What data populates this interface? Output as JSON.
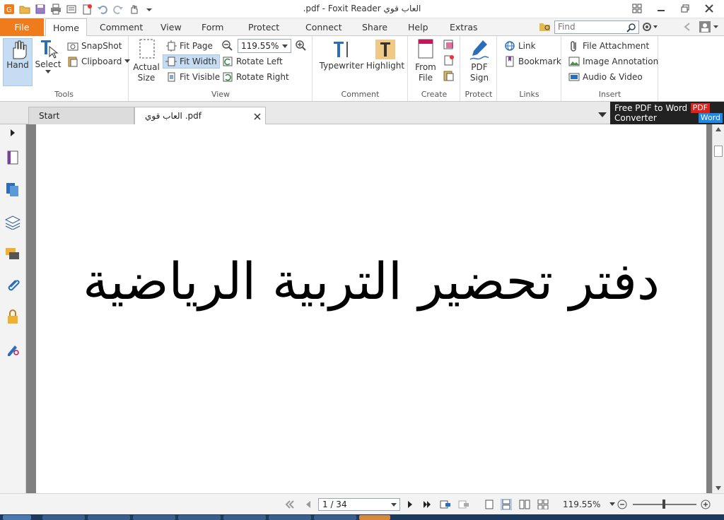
{
  "window": {
    "title": ".pdf - Foxit Reader العاب قوي",
    "controls": [
      "restore-layout",
      "minimize",
      "maximize",
      "close"
    ]
  },
  "ribbon_tabs": [
    "File",
    "Home",
    "Comment",
    "View",
    "Form",
    "Protect",
    "Connect",
    "Share",
    "Help",
    "Extras"
  ],
  "active_tab": "Home",
  "find": {
    "placeholder": "Find"
  },
  "groups": {
    "tools": {
      "label": "Tools",
      "hand": "Hand",
      "select": "Select",
      "snapshot": "SnapShot",
      "clipboard": "Clipboard"
    },
    "view": {
      "label": "View",
      "actual_size_1": "Actual",
      "actual_size_2": "Size",
      "fit_page": "Fit Page",
      "fit_width": "Fit Width",
      "fit_visible": "Fit Visible",
      "zoom": "119.55%",
      "rotate_left": "Rotate Left",
      "rotate_right": "Rotate Right"
    },
    "comment": {
      "label": "Comment",
      "typewriter": "Typewriter",
      "highlight": "Highlight"
    },
    "create": {
      "label": "Create",
      "from_file_1": "From",
      "from_file_2": "File"
    },
    "protect": {
      "label": "Protect",
      "pdf_sign_1": "PDF",
      "pdf_sign_2": "Sign"
    },
    "links": {
      "label": "Links",
      "link": "Link",
      "bookmark": "Bookmark"
    },
    "insert": {
      "label": "Insert",
      "file_attachment": "File Attachment",
      "image_annotation": "Image Annotation",
      "audio_video": "Audio & Video"
    }
  },
  "doc_tabs": {
    "start": "Start",
    "current": "العاب قوي .pdf"
  },
  "promo": {
    "line1": "Free PDF to Word",
    "line2": "Converter",
    "badge_pdf": "PDF",
    "badge_word": "Word"
  },
  "document": {
    "heading": "دفتر تحضير التربية الرياضية"
  },
  "status": {
    "page": "1 / 34",
    "zoom": "119.55%"
  },
  "colors": {
    "file_tab": "#f07b1c",
    "selected": "#c5dcf2",
    "doc_bg": "#808080"
  }
}
